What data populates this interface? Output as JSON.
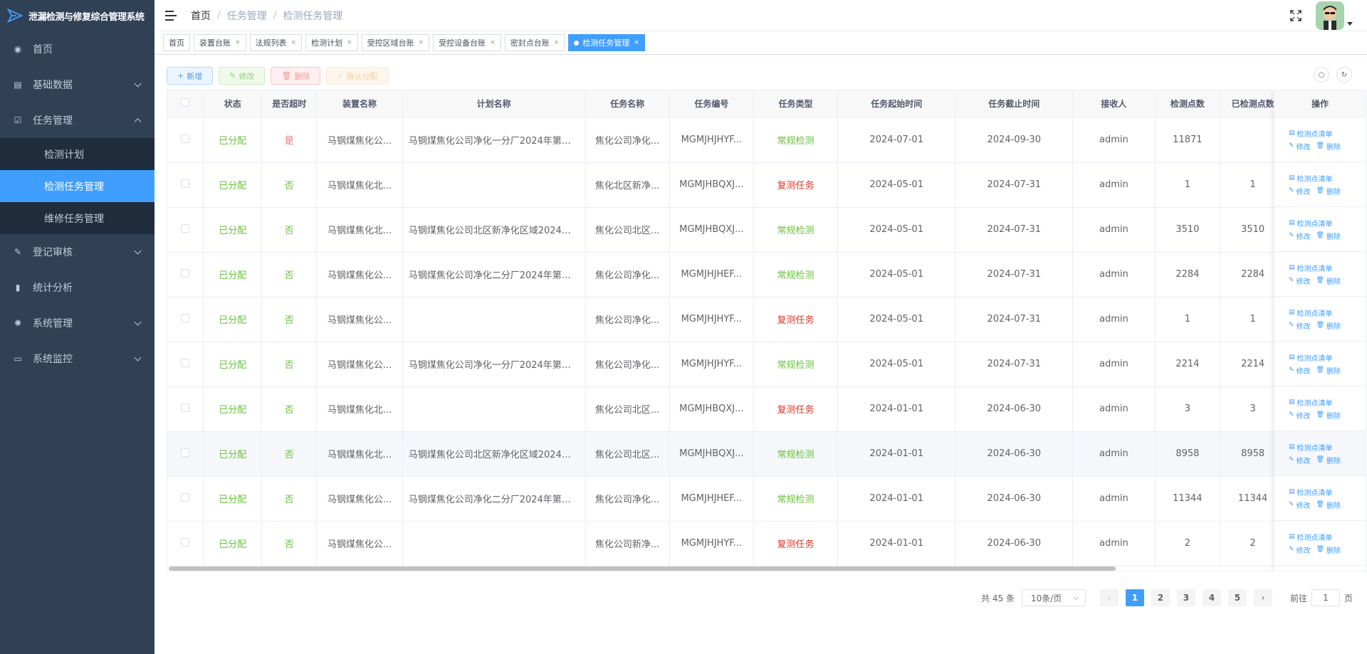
{
  "app": {
    "title": "泄漏检测与修复综合管理系统"
  },
  "sidebar": {
    "items": [
      {
        "label": "首页",
        "icon": "dashboard-icon",
        "expandable": false
      },
      {
        "label": "基础数据",
        "icon": "document-icon",
        "expandable": true
      },
      {
        "label": "任务管理",
        "icon": "checkbox-icon",
        "expandable": true,
        "expanded": true,
        "children": [
          {
            "label": "检测计划",
            "active": false
          },
          {
            "label": "检测任务管理",
            "active": true
          },
          {
            "label": "维修任务管理",
            "active": false
          }
        ]
      },
      {
        "label": "登记审核",
        "icon": "edit-icon",
        "expandable": true
      },
      {
        "label": "统计分析",
        "icon": "bar-chart-icon",
        "expandable": false
      },
      {
        "label": "系统管理",
        "icon": "gear-icon",
        "expandable": true
      },
      {
        "label": "系统监控",
        "icon": "monitor-icon",
        "expandable": true
      }
    ]
  },
  "breadcrumb": [
    "首页",
    "任务管理",
    "检测任务管理"
  ],
  "tags": [
    {
      "label": "首页",
      "closable": false,
      "active": false
    },
    {
      "label": "装置台账",
      "closable": true,
      "active": false
    },
    {
      "label": "法规列表",
      "closable": true,
      "active": false
    },
    {
      "label": "检测计划",
      "closable": true,
      "active": false
    },
    {
      "label": "受控区域台账",
      "closable": true,
      "active": false
    },
    {
      "label": "受控设备台账",
      "closable": true,
      "active": false
    },
    {
      "label": "密封点台账",
      "closable": true,
      "active": false
    },
    {
      "label": "检测任务管理",
      "closable": true,
      "active": true
    }
  ],
  "toolbar": {
    "add_label": "新增",
    "edit_label": "修改",
    "delete_label": "删除",
    "confirm_label": "确认分配"
  },
  "table": {
    "columns": [
      "状态",
      "是否超时",
      "装置名称",
      "计划名称",
      "任务名称",
      "任务编号",
      "任务类型",
      "任务起始时间",
      "任务截止时间",
      "接收人",
      "检测点数",
      "已检测点数"
    ],
    "op_header": "操作",
    "op_links": {
      "list": "检测点清单",
      "edit": "修改",
      "delete": "删除"
    },
    "rows": [
      {
        "status": "已分配",
        "overdue": "是",
        "device": "马钢煤焦化公...",
        "plan": "马钢煤焦化公司净化一分厂2024年第三...",
        "task": "焦化公司净化...",
        "code": "MGMJHJHYF...",
        "type": "常规检测",
        "start": "2024-07-01",
        "end": "2024-09-30",
        "receiver": "admin",
        "points": "11871",
        "done": ""
      },
      {
        "status": "已分配",
        "overdue": "否",
        "device": "马钢煤焦化北...",
        "plan": "",
        "task": "焦化北区新净...",
        "code": "MGMJHBQXJ...",
        "type": "复测任务",
        "start": "2024-05-01",
        "end": "2024-07-31",
        "receiver": "admin",
        "points": "1",
        "done": "1"
      },
      {
        "status": "已分配",
        "overdue": "否",
        "device": "马钢煤焦化北...",
        "plan": "马钢煤焦化公司北区新净化区域2024年...",
        "task": "焦化公司北区...",
        "code": "MGMJHBQXJ...",
        "type": "常规检测",
        "start": "2024-05-01",
        "end": "2024-07-31",
        "receiver": "admin",
        "points": "3510",
        "done": "3510"
      },
      {
        "status": "已分配",
        "overdue": "否",
        "device": "马钢煤焦化公...",
        "plan": "马钢煤焦化公司净化二分厂2024年第二...",
        "task": "焦化公司净化...",
        "code": "MGMJHJHEF...",
        "type": "常规检测",
        "start": "2024-05-01",
        "end": "2024-07-31",
        "receiver": "admin",
        "points": "2284",
        "done": "2284"
      },
      {
        "status": "已分配",
        "overdue": "否",
        "device": "马钢煤焦化公...",
        "plan": "",
        "task": "焦化公司净化...",
        "code": "MGMJHJHYF...",
        "type": "复测任务",
        "start": "2024-05-01",
        "end": "2024-07-31",
        "receiver": "admin",
        "points": "1",
        "done": "1"
      },
      {
        "status": "已分配",
        "overdue": "否",
        "device": "马钢煤焦化公...",
        "plan": "马钢煤焦化公司净化一分厂2024年第二...",
        "task": "焦化公司净化...",
        "code": "MGMJHJHYF...",
        "type": "常规检测",
        "start": "2024-05-01",
        "end": "2024-07-31",
        "receiver": "admin",
        "points": "2214",
        "done": "2214"
      },
      {
        "status": "已分配",
        "overdue": "否",
        "device": "马钢煤焦化北...",
        "plan": "",
        "task": "焦化公司北区...",
        "code": "MGMJHBQXJ...",
        "type": "复测任务",
        "start": "2024-01-01",
        "end": "2024-06-30",
        "receiver": "admin",
        "points": "3",
        "done": "3"
      },
      {
        "status": "已分配",
        "overdue": "否",
        "device": "马钢煤焦化北...",
        "plan": "马钢煤焦化公司北区新净化区域2024年...",
        "task": "焦化公司北区...",
        "code": "MGMJHBQXJ...",
        "type": "常规检测",
        "start": "2024-01-01",
        "end": "2024-06-30",
        "receiver": "admin",
        "points": "8958",
        "done": "8958"
      },
      {
        "status": "已分配",
        "overdue": "否",
        "device": "马钢煤焦化公...",
        "plan": "马钢煤焦化公司净化二分厂2024年第一...",
        "task": "焦化公司净化...",
        "code": "MGMJHJHEF...",
        "type": "常规检测",
        "start": "2024-01-01",
        "end": "2024-06-30",
        "receiver": "admin",
        "points": "11344",
        "done": "11344"
      },
      {
        "status": "已分配",
        "overdue": "否",
        "device": "马钢煤焦化公...",
        "plan": "",
        "task": "焦化公司新净...",
        "code": "MGMJHJHYF...",
        "type": "复测任务",
        "start": "2024-01-01",
        "end": "2024-06-30",
        "receiver": "admin",
        "points": "2",
        "done": "2"
      }
    ]
  },
  "pagination": {
    "total": "共 45 条",
    "page_size": "10条/页",
    "pages": [
      "1",
      "2",
      "3",
      "4",
      "5"
    ],
    "current": "1",
    "goto_prefix": "前往",
    "goto_value": "1",
    "goto_suffix": "页"
  },
  "colors": {
    "sidebar_bg": "#304156",
    "submenu_bg": "#1f2d3d",
    "accent": "#409eff",
    "success": "#67c23a",
    "danger": "#f56c6c",
    "retest": "#e0301e"
  }
}
